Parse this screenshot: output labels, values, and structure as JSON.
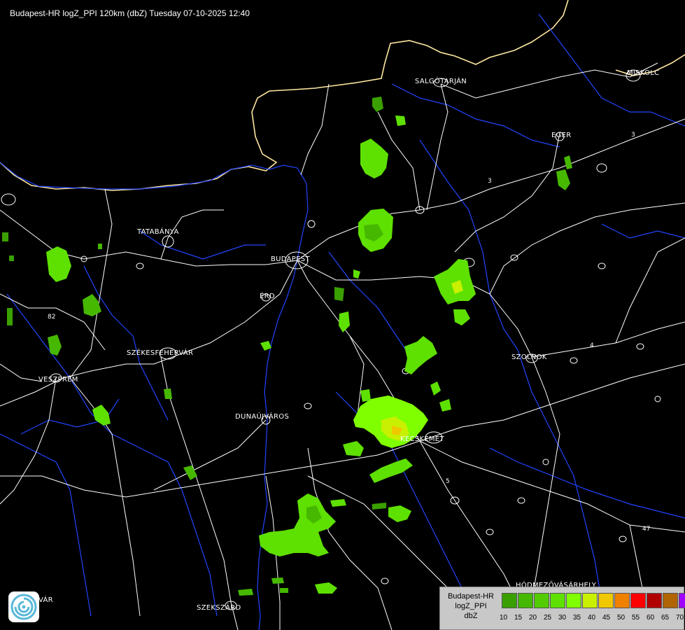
{
  "title": "Budapest-HR logZ_PPI 120km (dbZ) Tuesday 07-10-2025 12:40",
  "cities": {
    "salgotarjan": "SALGÓTARJÁN",
    "miskolc": "MISKOLC",
    "eger": "EGER",
    "tatabanya": "TATABÁNYA",
    "budapest": "BUDAPEST",
    "erd": "ÉRD",
    "szekesfehervar": "SZÉKESFEHÉRVÁR",
    "szolnok": "SZOLNOK",
    "veszprem": "VESZPRÉM",
    "dunaujvaros": "DUNAÚJVÁROS",
    "kecskemet": "KECSKEMÉT",
    "hodmezovasarhely": "HÓDMEZŐVÁSÁRHELY",
    "szekszard": "SZEKSZÁRD",
    "kaposvar": "KAPOSVÁR"
  },
  "road_numbers": {
    "r3a": "3",
    "r3b": "3",
    "r82": "82",
    "r47": "47",
    "r4": "4",
    "r5": "5"
  },
  "legend": {
    "line1": "Budapest-HR",
    "line2": "logZ_PPI",
    "line3": "dbZ",
    "scale": [
      {
        "value": "10",
        "color": "#3aa000"
      },
      {
        "value": "15",
        "color": "#46b800"
      },
      {
        "value": "20",
        "color": "#52cc00"
      },
      {
        "value": "25",
        "color": "#5ee000"
      },
      {
        "value": "30",
        "color": "#80ff00"
      },
      {
        "value": "35",
        "color": "#c8f000"
      },
      {
        "value": "40",
        "color": "#f0c800"
      },
      {
        "value": "45",
        "color": "#f08000"
      },
      {
        "value": "50",
        "color": "#ff0000"
      },
      {
        "value": "55",
        "color": "#b00000"
      },
      {
        "value": "60",
        "color": "#b06400"
      },
      {
        "value": "65",
        "color": "#a000ff"
      },
      {
        "value": "70",
        "color": "#a0a0ff"
      }
    ]
  },
  "colors": {
    "background": "#000000",
    "border": "#ffe8a0",
    "rivers": "#2244ff",
    "roads": "#ffffff"
  }
}
